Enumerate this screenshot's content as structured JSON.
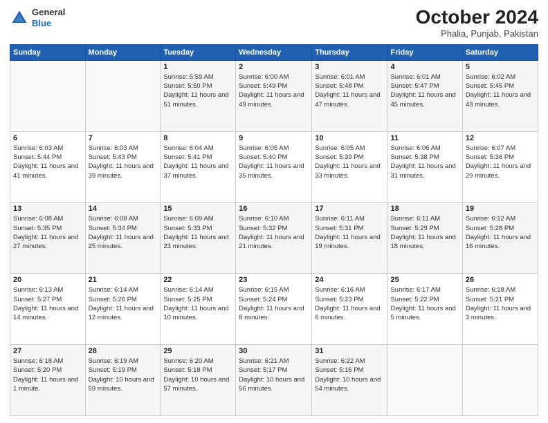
{
  "header": {
    "logo_line1": "General",
    "logo_line2": "Blue",
    "month_year": "October 2024",
    "location": "Phalia, Punjab, Pakistan"
  },
  "weekdays": [
    "Sunday",
    "Monday",
    "Tuesday",
    "Wednesday",
    "Thursday",
    "Friday",
    "Saturday"
  ],
  "weeks": [
    [
      {
        "day": "",
        "content": ""
      },
      {
        "day": "",
        "content": ""
      },
      {
        "day": "1",
        "content": "Sunrise: 5:59 AM\nSunset: 5:50 PM\nDaylight: 11 hours and 51 minutes."
      },
      {
        "day": "2",
        "content": "Sunrise: 6:00 AM\nSunset: 5:49 PM\nDaylight: 11 hours and 49 minutes."
      },
      {
        "day": "3",
        "content": "Sunrise: 6:01 AM\nSunset: 5:48 PM\nDaylight: 11 hours and 47 minutes."
      },
      {
        "day": "4",
        "content": "Sunrise: 6:01 AM\nSunset: 5:47 PM\nDaylight: 11 hours and 45 minutes."
      },
      {
        "day": "5",
        "content": "Sunrise: 6:02 AM\nSunset: 5:45 PM\nDaylight: 11 hours and 43 minutes."
      }
    ],
    [
      {
        "day": "6",
        "content": "Sunrise: 6:03 AM\nSunset: 5:44 PM\nDaylight: 11 hours and 41 minutes."
      },
      {
        "day": "7",
        "content": "Sunrise: 6:03 AM\nSunset: 5:43 PM\nDaylight: 11 hours and 39 minutes."
      },
      {
        "day": "8",
        "content": "Sunrise: 6:04 AM\nSunset: 5:41 PM\nDaylight: 11 hours and 37 minutes."
      },
      {
        "day": "9",
        "content": "Sunrise: 6:05 AM\nSunset: 5:40 PM\nDaylight: 11 hours and 35 minutes."
      },
      {
        "day": "10",
        "content": "Sunrise: 6:05 AM\nSunset: 5:39 PM\nDaylight: 11 hours and 33 minutes."
      },
      {
        "day": "11",
        "content": "Sunrise: 6:06 AM\nSunset: 5:38 PM\nDaylight: 11 hours and 31 minutes."
      },
      {
        "day": "12",
        "content": "Sunrise: 6:07 AM\nSunset: 5:36 PM\nDaylight: 11 hours and 29 minutes."
      }
    ],
    [
      {
        "day": "13",
        "content": "Sunrise: 6:08 AM\nSunset: 5:35 PM\nDaylight: 11 hours and 27 minutes."
      },
      {
        "day": "14",
        "content": "Sunrise: 6:08 AM\nSunset: 5:34 PM\nDaylight: 11 hours and 25 minutes."
      },
      {
        "day": "15",
        "content": "Sunrise: 6:09 AM\nSunset: 5:33 PM\nDaylight: 11 hours and 23 minutes."
      },
      {
        "day": "16",
        "content": "Sunrise: 6:10 AM\nSunset: 5:32 PM\nDaylight: 11 hours and 21 minutes."
      },
      {
        "day": "17",
        "content": "Sunrise: 6:11 AM\nSunset: 5:31 PM\nDaylight: 11 hours and 19 minutes."
      },
      {
        "day": "18",
        "content": "Sunrise: 6:11 AM\nSunset: 5:29 PM\nDaylight: 11 hours and 18 minutes."
      },
      {
        "day": "19",
        "content": "Sunrise: 6:12 AM\nSunset: 5:28 PM\nDaylight: 11 hours and 16 minutes."
      }
    ],
    [
      {
        "day": "20",
        "content": "Sunrise: 6:13 AM\nSunset: 5:27 PM\nDaylight: 11 hours and 14 minutes."
      },
      {
        "day": "21",
        "content": "Sunrise: 6:14 AM\nSunset: 5:26 PM\nDaylight: 11 hours and 12 minutes."
      },
      {
        "day": "22",
        "content": "Sunrise: 6:14 AM\nSunset: 5:25 PM\nDaylight: 11 hours and 10 minutes."
      },
      {
        "day": "23",
        "content": "Sunrise: 6:15 AM\nSunset: 5:24 PM\nDaylight: 11 hours and 8 minutes."
      },
      {
        "day": "24",
        "content": "Sunrise: 6:16 AM\nSunset: 5:23 PM\nDaylight: 11 hours and 6 minutes."
      },
      {
        "day": "25",
        "content": "Sunrise: 6:17 AM\nSunset: 5:22 PM\nDaylight: 11 hours and 5 minutes."
      },
      {
        "day": "26",
        "content": "Sunrise: 6:18 AM\nSunset: 5:21 PM\nDaylight: 11 hours and 3 minutes."
      }
    ],
    [
      {
        "day": "27",
        "content": "Sunrise: 6:18 AM\nSunset: 5:20 PM\nDaylight: 11 hours and 1 minute."
      },
      {
        "day": "28",
        "content": "Sunrise: 6:19 AM\nSunset: 5:19 PM\nDaylight: 10 hours and 59 minutes."
      },
      {
        "day": "29",
        "content": "Sunrise: 6:20 AM\nSunset: 5:18 PM\nDaylight: 10 hours and 57 minutes."
      },
      {
        "day": "30",
        "content": "Sunrise: 6:21 AM\nSunset: 5:17 PM\nDaylight: 10 hours and 56 minutes."
      },
      {
        "day": "31",
        "content": "Sunrise: 6:22 AM\nSunset: 5:16 PM\nDaylight: 10 hours and 54 minutes."
      },
      {
        "day": "",
        "content": ""
      },
      {
        "day": "",
        "content": ""
      }
    ]
  ]
}
